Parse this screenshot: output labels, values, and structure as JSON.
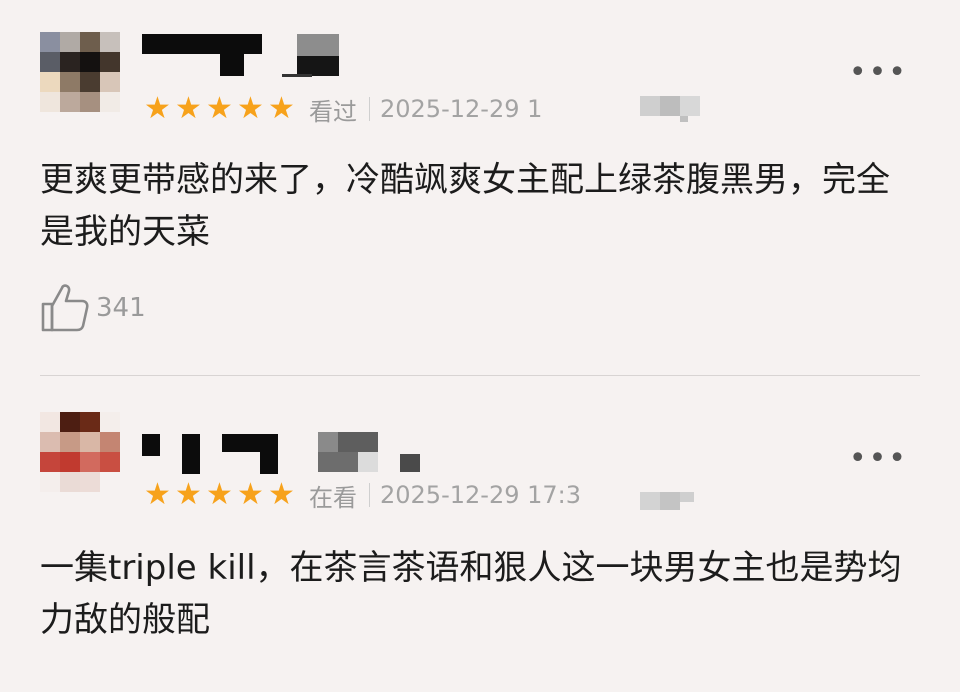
{
  "reviews": [
    {
      "status": "看过",
      "rating": 5,
      "date": "2025-12-29 1",
      "content": "更爽更带感的来了，冷酷飒爽女主配上绿茶腹黑男，完全是我的天菜",
      "likes": "341",
      "more_label": "•••"
    },
    {
      "status": "在看",
      "rating": 5,
      "date": "2025-12-29 17:3",
      "content": "一集triple kill，在茶言茶语和狠人这一块男女主也是势均力敌的般配",
      "more_label": "•••"
    }
  ],
  "colors": {
    "star": "#f7a21b",
    "background": "#f6f2f1",
    "meta_text": "#9a9a9a"
  },
  "icons": {
    "star": "star-icon",
    "like": "thumbs-up-icon",
    "more": "more-dots-icon"
  }
}
